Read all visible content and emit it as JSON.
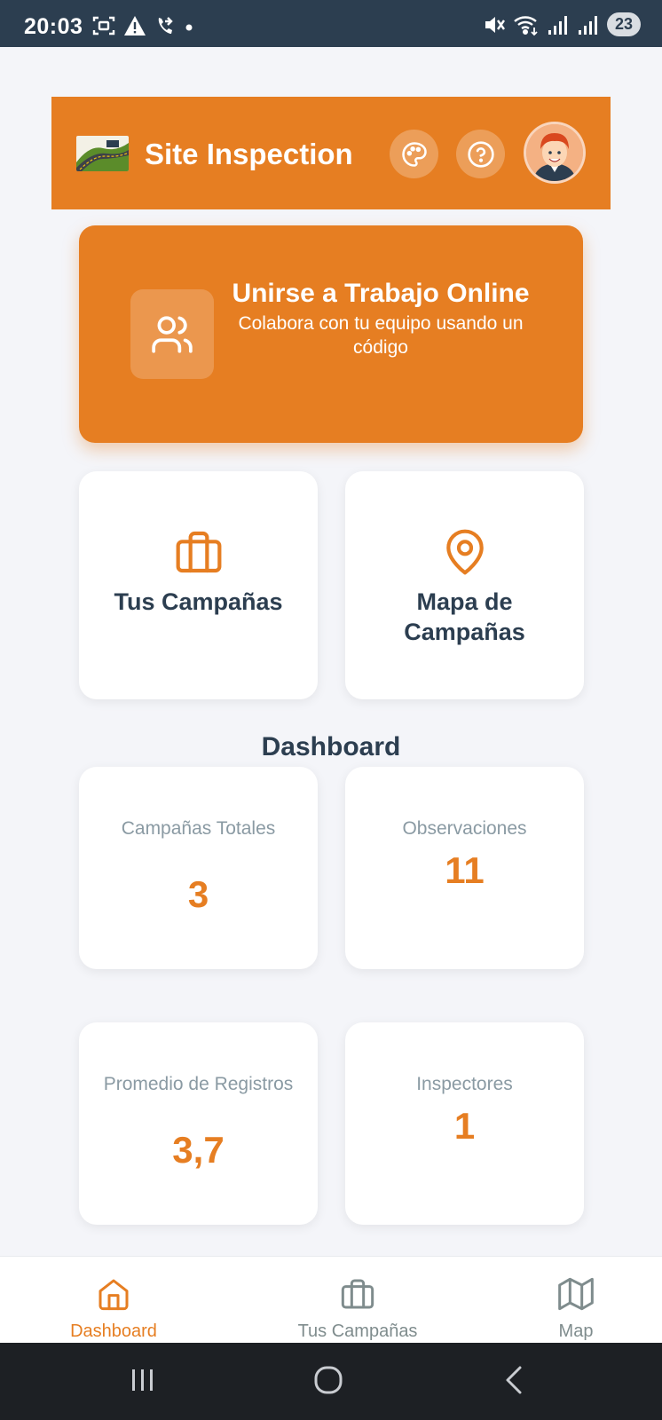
{
  "status_bar": {
    "time": "20:03",
    "battery": "23"
  },
  "header": {
    "title": "Site Inspection",
    "theme_icon": "palette-icon",
    "help_icon": "help-circle-icon"
  },
  "join_card": {
    "title": "Unirse a Trabajo Online",
    "subtitle": "Colabora con tu equipo usando un código",
    "icon": "users-icon"
  },
  "nav_cards": [
    {
      "label": "Tus Campañas",
      "icon": "briefcase-icon"
    },
    {
      "label": "Mapa de Campañas",
      "icon": "map-pin-icon"
    }
  ],
  "dashboard": {
    "title": "Dashboard",
    "stats": [
      {
        "label": "Campañas Totales",
        "value": "3"
      },
      {
        "label": "Observaciones",
        "value": "11"
      },
      {
        "label": "Promedio de Registros",
        "value": "3,7"
      },
      {
        "label": "Inspectores",
        "value": "1"
      }
    ]
  },
  "bottom_nav": [
    {
      "label": "Dashboard",
      "icon": "home-icon",
      "active": true
    },
    {
      "label": "Tus Campañas",
      "icon": "briefcase-icon",
      "active": false
    },
    {
      "label": "Map",
      "icon": "map-icon",
      "active": false
    }
  ],
  "colors": {
    "accent": "#e67e22",
    "dark": "#2c3e50",
    "muted": "#8a9aa3",
    "inactive_nav": "#7f8c8d"
  }
}
